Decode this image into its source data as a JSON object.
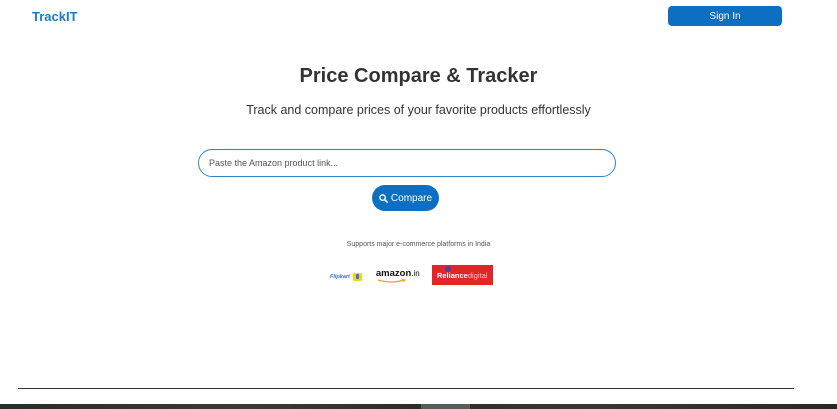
{
  "header": {
    "brand": "TrackIT",
    "signin_label": "Sign In"
  },
  "hero": {
    "title": "Price Compare & Tracker",
    "subtitle": "Track and compare prices of your favorite products effortlessly"
  },
  "search": {
    "placeholder": "Paste the Amazon product link...",
    "value": ""
  },
  "compare_button": {
    "label": "Compare",
    "icon": "search-icon"
  },
  "platforms": {
    "caption": "Supports major e-commerce platforms in India",
    "logos": [
      {
        "name": "Flipkart",
        "text": "Flipkart"
      },
      {
        "name": "Amazon",
        "text": "amazon",
        "suffix": ".in"
      },
      {
        "name": "Reliance Digital",
        "text": "Reliance",
        "suffix": "digital"
      }
    ]
  },
  "colors": {
    "brand": "#1b7bc4",
    "button": "#0d6fc1",
    "input_border": "#2a86d1"
  }
}
